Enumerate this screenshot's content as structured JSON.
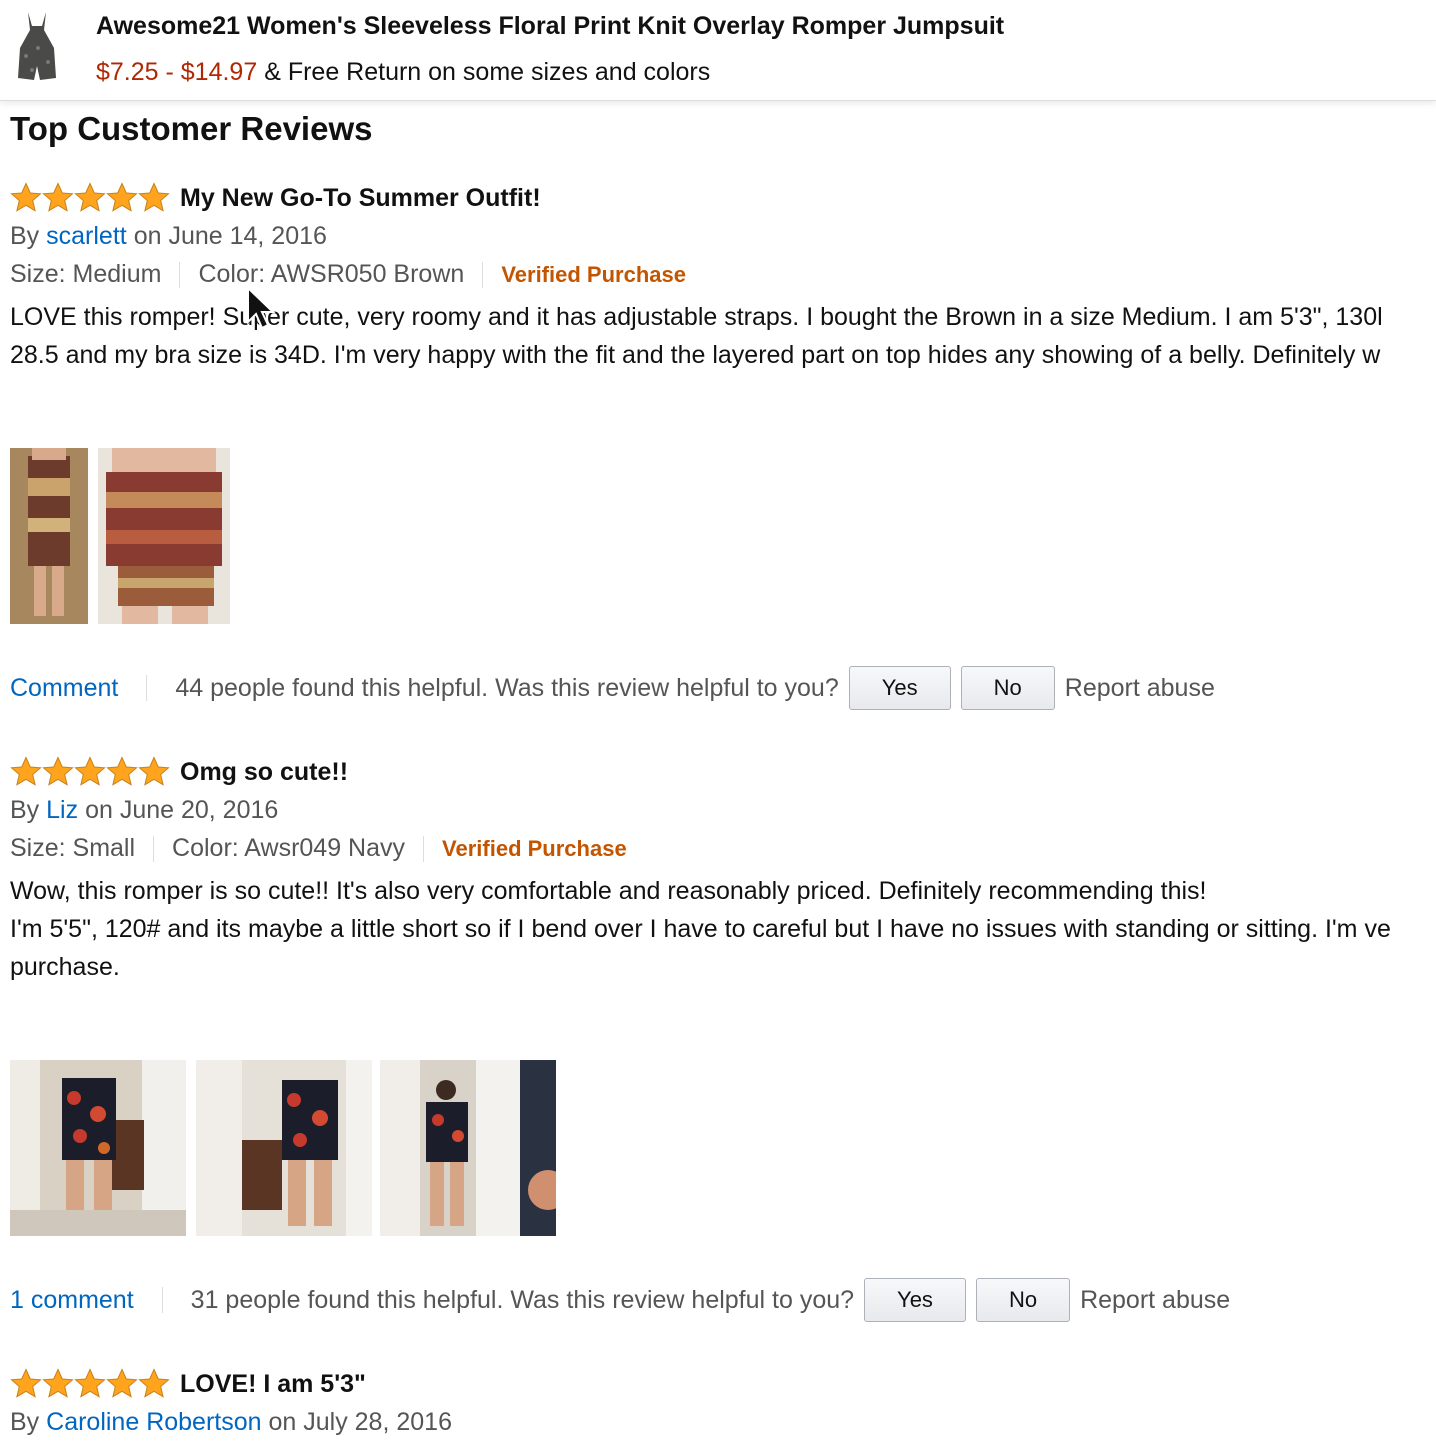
{
  "product": {
    "title": "Awesome21 Women's Sleeveless Floral Print Knit Overlay Romper Jumpsuit",
    "price": "$7.25 - $14.97",
    "shipping": "& Free Return on some sizes and colors"
  },
  "section_title": "Top Customer Reviews",
  "colors": {
    "price": "#b12704",
    "link": "#0066c0",
    "verified": "#c45500",
    "star": "#ffa41c"
  },
  "reviews": [
    {
      "rating": 5,
      "title": "My New Go-To Summer Outfit!",
      "by": "By",
      "author": "scarlett",
      "date": "on June 14, 2016",
      "size": "Size: Medium",
      "color": "Color: AWSR050 Brown",
      "verified": "Verified Purchase",
      "body": "LOVE this romper! Super cute, very roomy and it has adjustable straps. I bought the Brown in a size Medium. I am 5'3\", 130l\n28.5 and my bra size is 34D. I'm very happy with the fit and the layered part on top hides any showing of a belly. Definitely w",
      "comment_label": "Comment",
      "helpful_text": "44 people found this helpful. Was this review helpful to you?",
      "yes": "Yes",
      "no": "No",
      "report": "Report abuse"
    },
    {
      "rating": 5,
      "title": "Omg so cute!!",
      "by": "By",
      "author": "Liz",
      "date": "on June 20, 2016",
      "size": "Size: Small",
      "color": "Color: Awsr049 Navy",
      "verified": "Verified Purchase",
      "body": "Wow, this romper is so cute!! It's also very comfortable and reasonably priced. Definitely recommending this!\nI'm 5'5\", 120# and its maybe a little short so if I bend over I have to careful but I have no issues with standing or sitting. I'm ve\npurchase.",
      "comment_label": "1 comment",
      "helpful_text": "31 people found this helpful. Was this review helpful to you?",
      "yes": "Yes",
      "no": "No",
      "report": "Report abuse"
    },
    {
      "rating": 5,
      "title": "LOVE! I am 5'3\"",
      "by": "By",
      "author": "Caroline Robertson",
      "date": "on July 28, 2016"
    }
  ]
}
